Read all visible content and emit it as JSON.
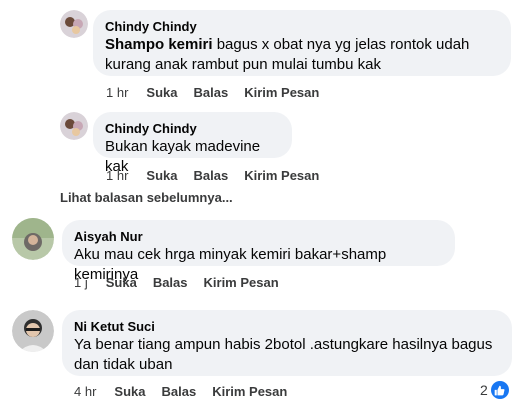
{
  "comments": [
    {
      "author": "Chindy Chindy",
      "text_bold": "Shampo kemiri",
      "text": " bagus x obat nya yg jelas rontok udah kurang anak rambut pun mulai tumbu kak",
      "time": "1 hr",
      "like": "Suka",
      "reply": "Balas",
      "message": "Kirim Pesan"
    },
    {
      "author": "Chindy Chindy",
      "text": "Bukan kayak madevine kak",
      "time": "1 hr",
      "like": "Suka",
      "reply": "Balas",
      "message": "Kirim Pesan"
    },
    {
      "author": "Aisyah Nur",
      "text": "Aku mau cek hrga minyak kemiri bakar+shamp kemirinya",
      "time": "1 j",
      "like": "Suka",
      "reply": "Balas",
      "message": "Kirim Pesan"
    },
    {
      "author": "Ni Ketut Suci",
      "text": "Ya benar tiang ampun habis 2botol .astungkare hasilnya bagus dan tidak uban",
      "time": "4 hr",
      "like": "Suka",
      "reply": "Balas",
      "message": "Kirim Pesan",
      "reaction_count": "2"
    }
  ],
  "more_replies": "Lihat balasan sebelumnya...",
  "icons": {
    "reaction": "like-icon"
  },
  "colors": {
    "bubble": "#f0f2f5",
    "like_badge": "#1877f2"
  }
}
